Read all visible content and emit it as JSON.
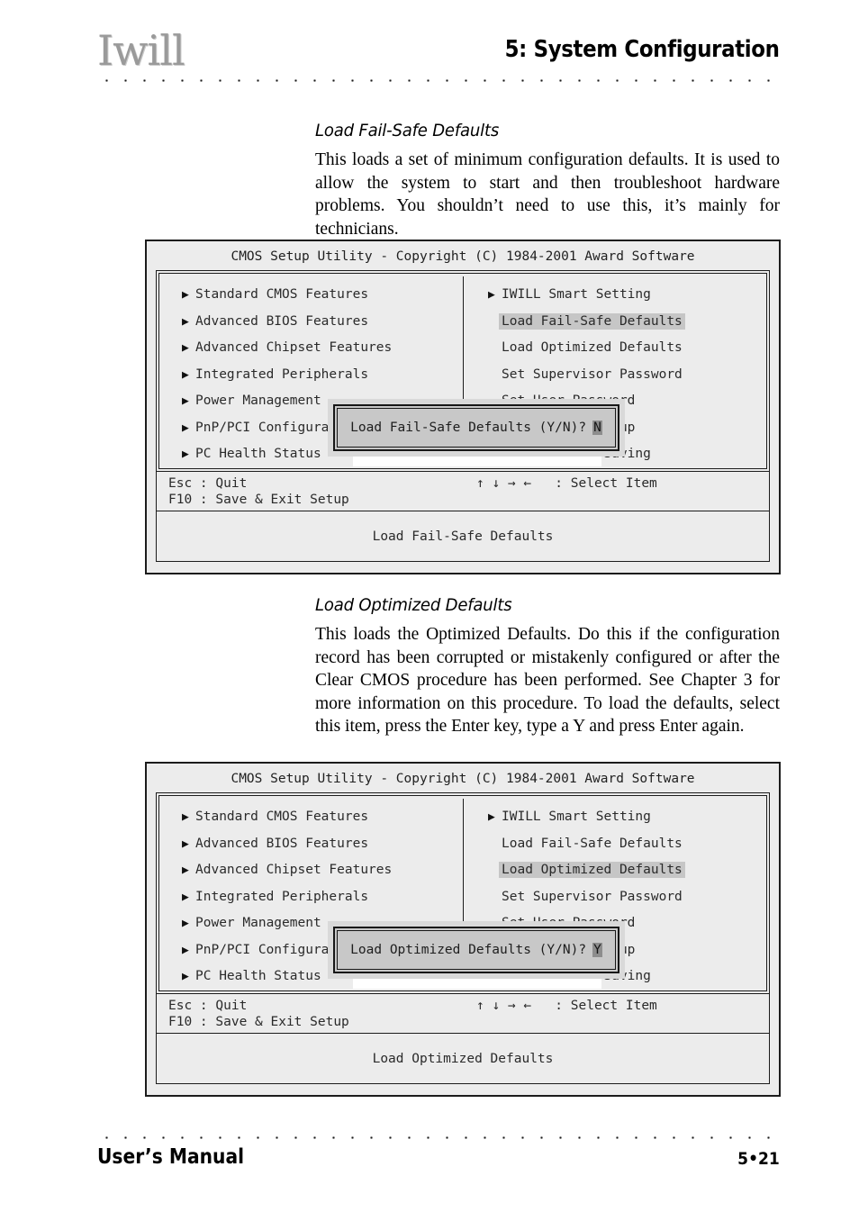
{
  "header": {
    "logo": "Iwill",
    "title": "5: System Configuration"
  },
  "footer": {
    "left": "User’s Manual",
    "page": "5•21"
  },
  "sections": [
    {
      "heading": "Load Fail-Safe Defaults",
      "body": "This loads a set of minimum configuration defaults. It is used to allow the system to start and then troubleshoot hardware problems. You shouldn’t need to use this, it’s mainly for technicians."
    },
    {
      "heading": "Load Optimized Defaults",
      "body": "This loads the Optimized Defaults. Do this if the configuration record has been corrupted or mistakenly configured or after the Clear CMOS procedure has been performed. See Chapter 3 for more information on this procedure. To load the defaults, select this item, press the Enter key, type a Y and press Enter again."
    }
  ],
  "bios_common": {
    "title": "CMOS Setup Utility - Copyright (C) 1984-2001 Award Software",
    "left_menu": [
      "Standard CMOS Features",
      "Advanced BIOS Features",
      "Advanced Chipset Features",
      "Integrated Peripherals",
      "Power Management",
      "PnP/PCI Configuration",
      "PC Health Status"
    ],
    "right_menu": [
      "IWILL Smart Setting",
      "Load Fail-Safe Defaults",
      "Load Optimized Defaults",
      "Set Supervisor Password",
      "Set User Password",
      "Save & Exit Setup",
      "Exit Without Saving"
    ],
    "key_help_line1": "Esc : Quit",
    "key_help_line2": "F10 : Save & Exit Setup",
    "select_item_help": "↑ ↓ → ←   : Select Item",
    "arrow_glyph": "▶"
  },
  "bios_screens": [
    {
      "highlight": "Load Fail-Safe Defaults",
      "dialog_prompt": "Load Fail-Safe Defaults (Y/N)?",
      "dialog_answer": "N",
      "status": "Load Fail-Safe Defaults"
    },
    {
      "highlight": "Load Optimized Defaults",
      "dialog_prompt": "Load Optimized Defaults (Y/N)?",
      "dialog_answer": "Y",
      "status": "Load Optimized Defaults"
    }
  ],
  "colors": {
    "panel_bg": "#ececec",
    "dialog_bg": "#c8c8c8",
    "highlight_bg": "#c6c6c6",
    "cursor_bg": "#8d8d8d",
    "border": "#1c1c1c",
    "logo_gray": "#9a9a9a"
  }
}
